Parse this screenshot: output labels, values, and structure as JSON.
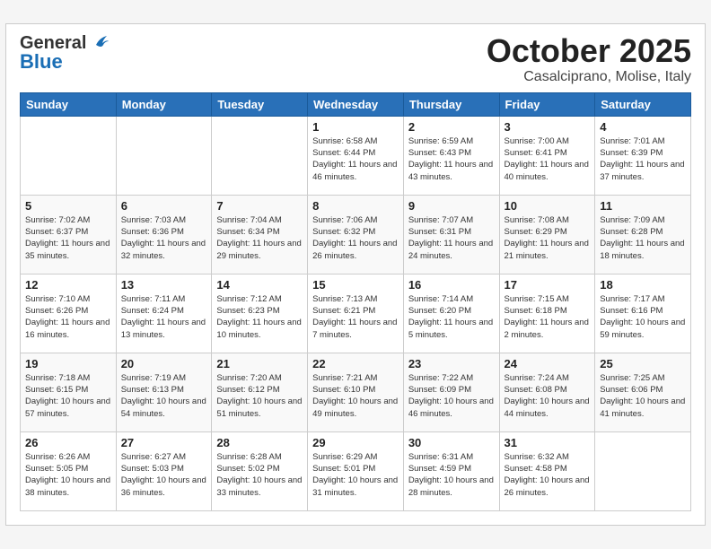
{
  "header": {
    "logo": {
      "general_text": "General",
      "blue_text": "Blue"
    },
    "month_title": "October 2025",
    "subtitle": "Casalciprano, Molise, Italy"
  },
  "weekdays": [
    "Sunday",
    "Monday",
    "Tuesday",
    "Wednesday",
    "Thursday",
    "Friday",
    "Saturday"
  ],
  "weeks": [
    [
      {
        "day": "",
        "info": ""
      },
      {
        "day": "",
        "info": ""
      },
      {
        "day": "",
        "info": ""
      },
      {
        "day": "1",
        "info": "Sunrise: 6:58 AM\nSunset: 6:44 PM\nDaylight: 11 hours\nand 46 minutes."
      },
      {
        "day": "2",
        "info": "Sunrise: 6:59 AM\nSunset: 6:43 PM\nDaylight: 11 hours\nand 43 minutes."
      },
      {
        "day": "3",
        "info": "Sunrise: 7:00 AM\nSunset: 6:41 PM\nDaylight: 11 hours\nand 40 minutes."
      },
      {
        "day": "4",
        "info": "Sunrise: 7:01 AM\nSunset: 6:39 PM\nDaylight: 11 hours\nand 37 minutes."
      }
    ],
    [
      {
        "day": "5",
        "info": "Sunrise: 7:02 AM\nSunset: 6:37 PM\nDaylight: 11 hours\nand 35 minutes."
      },
      {
        "day": "6",
        "info": "Sunrise: 7:03 AM\nSunset: 6:36 PM\nDaylight: 11 hours\nand 32 minutes."
      },
      {
        "day": "7",
        "info": "Sunrise: 7:04 AM\nSunset: 6:34 PM\nDaylight: 11 hours\nand 29 minutes."
      },
      {
        "day": "8",
        "info": "Sunrise: 7:06 AM\nSunset: 6:32 PM\nDaylight: 11 hours\nand 26 minutes."
      },
      {
        "day": "9",
        "info": "Sunrise: 7:07 AM\nSunset: 6:31 PM\nDaylight: 11 hours\nand 24 minutes."
      },
      {
        "day": "10",
        "info": "Sunrise: 7:08 AM\nSunset: 6:29 PM\nDaylight: 11 hours\nand 21 minutes."
      },
      {
        "day": "11",
        "info": "Sunrise: 7:09 AM\nSunset: 6:28 PM\nDaylight: 11 hours\nand 18 minutes."
      }
    ],
    [
      {
        "day": "12",
        "info": "Sunrise: 7:10 AM\nSunset: 6:26 PM\nDaylight: 11 hours\nand 16 minutes."
      },
      {
        "day": "13",
        "info": "Sunrise: 7:11 AM\nSunset: 6:24 PM\nDaylight: 11 hours\nand 13 minutes."
      },
      {
        "day": "14",
        "info": "Sunrise: 7:12 AM\nSunset: 6:23 PM\nDaylight: 11 hours\nand 10 minutes."
      },
      {
        "day": "15",
        "info": "Sunrise: 7:13 AM\nSunset: 6:21 PM\nDaylight: 11 hours\nand 7 minutes."
      },
      {
        "day": "16",
        "info": "Sunrise: 7:14 AM\nSunset: 6:20 PM\nDaylight: 11 hours\nand 5 minutes."
      },
      {
        "day": "17",
        "info": "Sunrise: 7:15 AM\nSunset: 6:18 PM\nDaylight: 11 hours\nand 2 minutes."
      },
      {
        "day": "18",
        "info": "Sunrise: 7:17 AM\nSunset: 6:16 PM\nDaylight: 10 hours\nand 59 minutes."
      }
    ],
    [
      {
        "day": "19",
        "info": "Sunrise: 7:18 AM\nSunset: 6:15 PM\nDaylight: 10 hours\nand 57 minutes."
      },
      {
        "day": "20",
        "info": "Sunrise: 7:19 AM\nSunset: 6:13 PM\nDaylight: 10 hours\nand 54 minutes."
      },
      {
        "day": "21",
        "info": "Sunrise: 7:20 AM\nSunset: 6:12 PM\nDaylight: 10 hours\nand 51 minutes."
      },
      {
        "day": "22",
        "info": "Sunrise: 7:21 AM\nSunset: 6:10 PM\nDaylight: 10 hours\nand 49 minutes."
      },
      {
        "day": "23",
        "info": "Sunrise: 7:22 AM\nSunset: 6:09 PM\nDaylight: 10 hours\nand 46 minutes."
      },
      {
        "day": "24",
        "info": "Sunrise: 7:24 AM\nSunset: 6:08 PM\nDaylight: 10 hours\nand 44 minutes."
      },
      {
        "day": "25",
        "info": "Sunrise: 7:25 AM\nSunset: 6:06 PM\nDaylight: 10 hours\nand 41 minutes."
      }
    ],
    [
      {
        "day": "26",
        "info": "Sunrise: 6:26 AM\nSunset: 5:05 PM\nDaylight: 10 hours\nand 38 minutes."
      },
      {
        "day": "27",
        "info": "Sunrise: 6:27 AM\nSunset: 5:03 PM\nDaylight: 10 hours\nand 36 minutes."
      },
      {
        "day": "28",
        "info": "Sunrise: 6:28 AM\nSunset: 5:02 PM\nDaylight: 10 hours\nand 33 minutes."
      },
      {
        "day": "29",
        "info": "Sunrise: 6:29 AM\nSunset: 5:01 PM\nDaylight: 10 hours\nand 31 minutes."
      },
      {
        "day": "30",
        "info": "Sunrise: 6:31 AM\nSunset: 4:59 PM\nDaylight: 10 hours\nand 28 minutes."
      },
      {
        "day": "31",
        "info": "Sunrise: 6:32 AM\nSunset: 4:58 PM\nDaylight: 10 hours\nand 26 minutes."
      },
      {
        "day": "",
        "info": ""
      }
    ]
  ]
}
